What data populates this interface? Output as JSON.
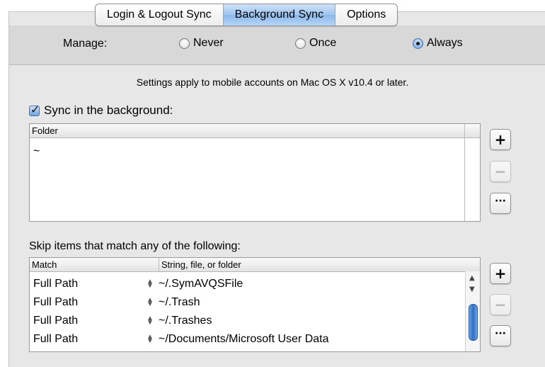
{
  "tabs": [
    "Login & Logout Sync",
    "Background Sync",
    "Options"
  ],
  "manage": {
    "label": "Manage:",
    "options": [
      "Never",
      "Once",
      "Always"
    ],
    "selected": "Always"
  },
  "note": "Settings apply to mobile accounts on Mac OS X v10.4 or later.",
  "sync_checkbox": {
    "label": "Sync in the background:",
    "checked": true
  },
  "folder_list": {
    "header": "Folder",
    "items": [
      "~"
    ]
  },
  "skip": {
    "label": "Skip items that match any of the following:",
    "headers": {
      "match": "Match",
      "value": "String, file, or folder"
    },
    "rows": [
      {
        "match": "Full Path",
        "value": "~/.SymAVQSFile"
      },
      {
        "match": "Full Path",
        "value": "~/.Trash"
      },
      {
        "match": "Full Path",
        "value": "~/.Trashes"
      },
      {
        "match": "Full Path",
        "value": "~/Documents/Microsoft User Data"
      }
    ]
  },
  "buttons": {
    "add": "+",
    "remove": "−",
    "edit": "···"
  },
  "icons": [
    "add-icon",
    "remove-icon",
    "ellipsis-icon",
    "scroll-up-icon",
    "scroll-down-icon"
  ]
}
